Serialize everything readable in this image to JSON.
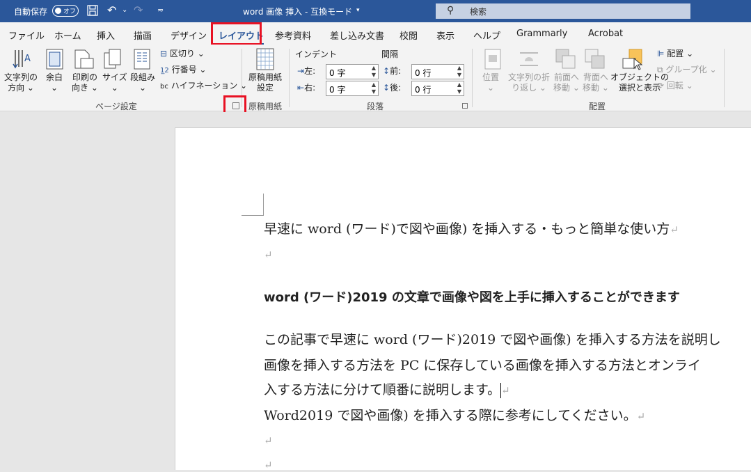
{
  "titlebar": {
    "autosave_label": "自動保存",
    "autosave_state": "オフ",
    "doc_title": "word 画像 挿入 - 互換モード",
    "search_placeholder": "検索"
  },
  "tabs": [
    "ファイル",
    "ホーム",
    "挿入",
    "描画",
    "デザイン",
    "レイアウト",
    "参考資料",
    "差し込み文書",
    "校閲",
    "表示",
    "ヘルプ",
    "Grammarly",
    "Acrobat"
  ],
  "active_tab": "レイアウト",
  "ribbon": {
    "page_setup": {
      "text_direction": [
        "文字列の",
        "方向"
      ],
      "margins": "余白",
      "orientation": [
        "印刷の",
        "向き"
      ],
      "size": "サイズ",
      "columns": "段組み",
      "breaks": "区切り",
      "line_numbers": "行番号",
      "hyphenation": "ハイフネーション",
      "group_label": "ページ設定"
    },
    "genko": {
      "button": [
        "原稿用紙",
        "設定"
      ],
      "group_label": "原稿用紙"
    },
    "paragraph": {
      "indent_label": "インデント",
      "spacing_label": "間隔",
      "left_label": "左:",
      "right_label": "右:",
      "before_label": "前:",
      "after_label": "後:",
      "left_value": "0 字",
      "right_value": "0 字",
      "before_value": "0 行",
      "after_value": "0 行",
      "group_label": "段落"
    },
    "arrange": {
      "position": "位置",
      "wrap_text": [
        "文字列の折",
        "り返し"
      ],
      "bring_forward": [
        "前面へ",
        "移動"
      ],
      "send_backward": [
        "背面へ",
        "移動"
      ],
      "selection_pane": [
        "オブジェクトの",
        "選択と表示"
      ],
      "align": "配置",
      "group": "グループ化",
      "rotate": "回転",
      "group_label": "配置"
    }
  },
  "document": {
    "line1": "早速に word (ワード)で図や画像) を挿入する・もっと簡単な使い方",
    "line2": "word (ワード)2019 の文章で画像や図を上手に挿入することができます",
    "line3": "この記事で早速に word (ワード)2019 で図や画像) を挿入する方法を説明し",
    "line4": "画像を挿入する方法を PC に保存している画像を挿入する方法とオンライ",
    "line5": "入する方法に分けて順番に説明します。",
    "line6": "Word2019 で図や画像) を挿入する際に参考にしてください。",
    "para_mark": "↵"
  },
  "colors": {
    "title_bar": "#2b579a",
    "highlight_box": "#e81123",
    "ribbon_bg": "#f3f3f3"
  }
}
